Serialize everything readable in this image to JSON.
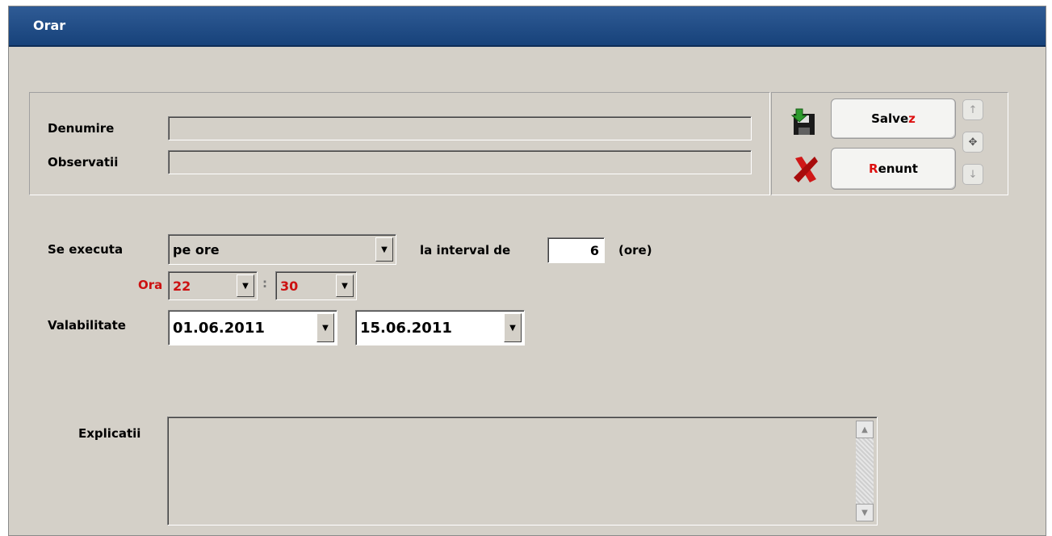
{
  "window": {
    "title": "Orar"
  },
  "form": {
    "denumire_label": "Denumire",
    "denumire_value": "",
    "observatii_label": "Observatii",
    "observatii_value": ""
  },
  "buttons": {
    "save_hotkey": "z",
    "save_prefix": "Salve",
    "cancel_hotkey": "R",
    "cancel_suffix": "enunt",
    "nav_up": "↑",
    "nav_move": "✥",
    "nav_down": "↓"
  },
  "schedule": {
    "se_executa_label": "Se executa",
    "se_executa_value": "pe ore",
    "interval_label": "la interval de",
    "interval_value": "6",
    "interval_unit": "(ore)",
    "ora_label": "Ora",
    "hour_value": "22",
    "time_separator": ":",
    "minute_value": "30",
    "valabilitate_label": "Valabilitate",
    "date_from": "01.06.2011",
    "date_to": "15.06.2011"
  },
  "explicatii": {
    "label": "Explicatii",
    "value": ""
  },
  "colors": {
    "titlebar": "#1f4a85",
    "hotkey": "#cc1111",
    "window_bg": "#d4d0c8"
  },
  "icons": {
    "save": "save-disk-icon",
    "cancel": "red-x-icon"
  }
}
